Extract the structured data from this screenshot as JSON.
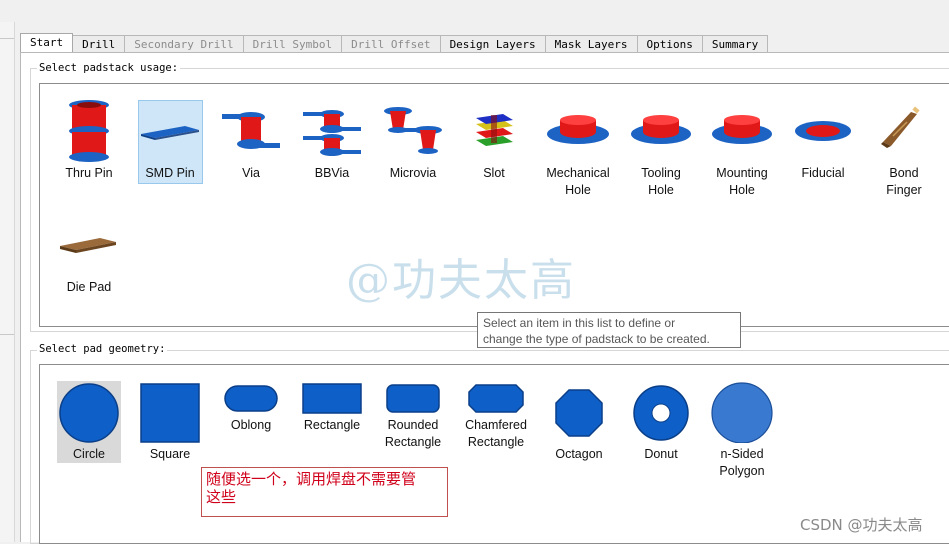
{
  "tabs": [
    {
      "label": "Start",
      "active": true
    },
    {
      "label": "Drill"
    },
    {
      "label": "Secondary Drill",
      "disabled": true
    },
    {
      "label": "Drill Symbol",
      "disabled": true
    },
    {
      "label": "Drill Offset",
      "disabled": true
    },
    {
      "label": "Design Layers"
    },
    {
      "label": "Mask Layers"
    },
    {
      "label": "Options"
    },
    {
      "label": "Summary"
    }
  ],
  "usage": {
    "group_label": "Select padstack usage:",
    "items": [
      {
        "l1": "Thru Pin",
        "icon": "thru-pin-icon"
      },
      {
        "l1": "SMD Pin",
        "icon": "smd-pin-icon",
        "selected": true
      },
      {
        "l1": "Via",
        "icon": "via-icon"
      },
      {
        "l1": "BBVia",
        "icon": "bbvia-icon"
      },
      {
        "l1": "Microvia",
        "icon": "microvia-icon"
      },
      {
        "l1": "Slot",
        "icon": "slot-icon"
      },
      {
        "l1": "Mechanical",
        "l2": "Hole",
        "icon": "mechanical-hole-icon"
      },
      {
        "l1": "Tooling",
        "l2": "Hole",
        "icon": "tooling-hole-icon"
      },
      {
        "l1": "Mounting",
        "l2": "Hole",
        "icon": "mounting-hole-icon"
      },
      {
        "l1": "Fiducial",
        "icon": "fiducial-icon"
      },
      {
        "l1": "Bond",
        "l2": "Finger",
        "icon": "bond-finger-icon"
      },
      {
        "l1": "Die Pad",
        "icon": "die-pad-icon"
      }
    ]
  },
  "geometry": {
    "group_label": "Select pad geometry:",
    "items": [
      {
        "l1": "Circle",
        "icon": "circle-shape-icon",
        "selected": true
      },
      {
        "l1": "Square",
        "icon": "square-shape-icon"
      },
      {
        "l1": "Oblong",
        "icon": "oblong-shape-icon"
      },
      {
        "l1": "Rectangle",
        "icon": "rectangle-shape-icon"
      },
      {
        "l1": "Rounded",
        "l2": "Rectangle",
        "icon": "rounded-rectangle-shape-icon"
      },
      {
        "l1": "Chamfered",
        "l2": "Rectangle",
        "icon": "chamfered-rectangle-shape-icon"
      },
      {
        "l1": "Octagon",
        "icon": "octagon-shape-icon"
      },
      {
        "l1": "Donut",
        "icon": "donut-shape-icon"
      },
      {
        "l1": "n-Sided",
        "l2": "Polygon",
        "icon": "n-sided-polygon-shape-icon"
      }
    ]
  },
  "tooltip": {
    "line1": "Select an item in this list to define or",
    "line2": "change the type of padstack to be created."
  },
  "watermark": "@功夫太高",
  "annotation": {
    "line1": "随便选一个，调用焊盘不需要管",
    "line2": "这些"
  },
  "csdn_credit": "CSDN @功夫太高",
  "colors": {
    "pad_red": "#e01818",
    "pad_blue": "#1d63c4",
    "selection": "#cfe6f8",
    "annotation_red": "#d0021b"
  }
}
